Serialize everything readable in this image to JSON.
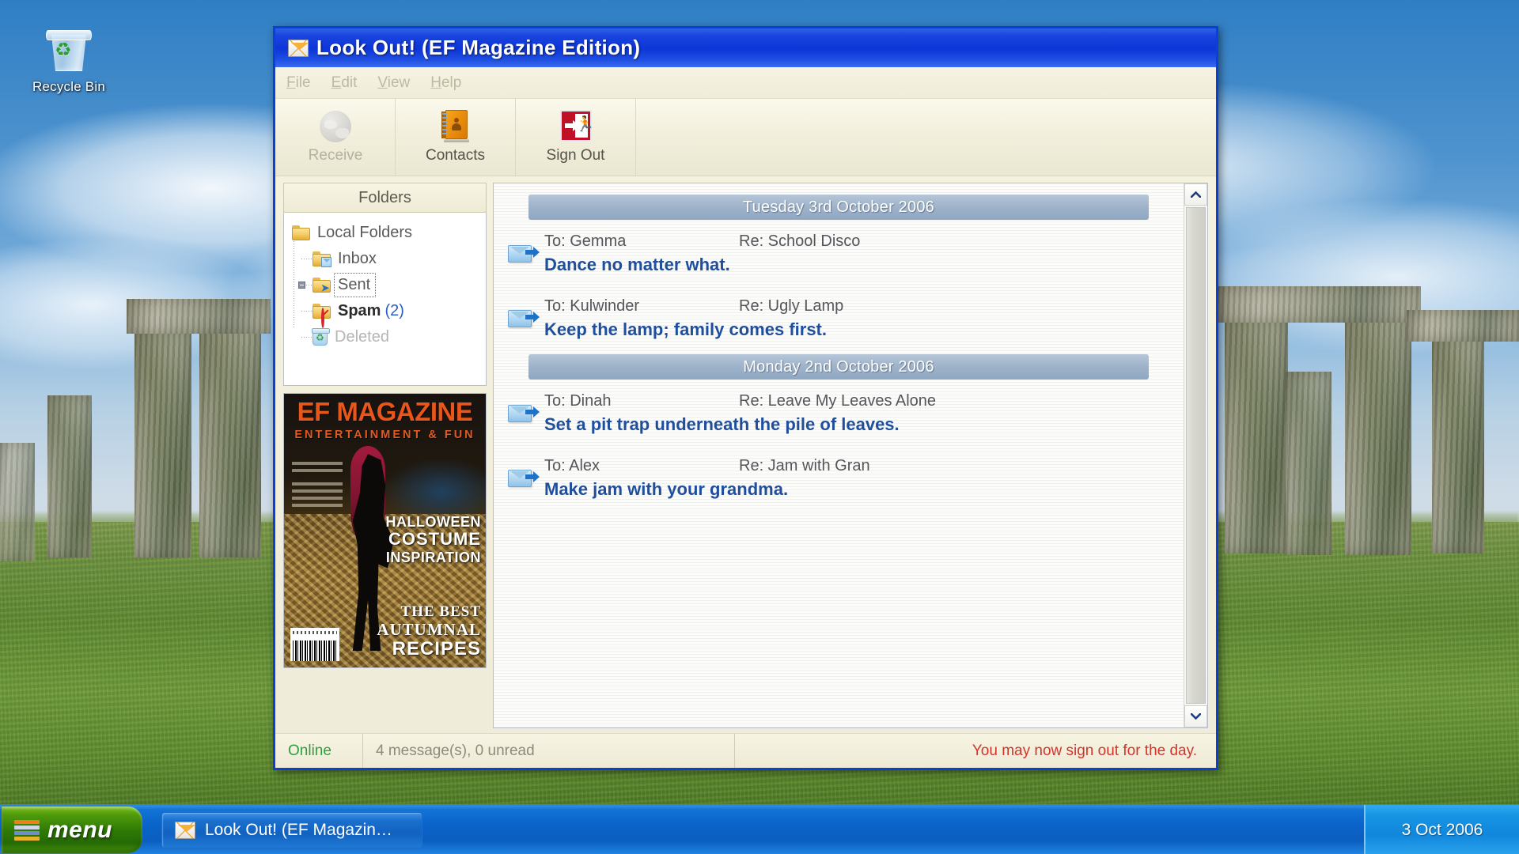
{
  "desktop": {
    "icons": [
      {
        "label": "Recycle Bin",
        "icon": "recycle-bin-icon"
      }
    ]
  },
  "window": {
    "title": "Look Out! (EF Magazine Edition)",
    "title_icon": "envelope-icon",
    "menu": [
      {
        "label": "File",
        "accel": "F",
        "disabled": true
      },
      {
        "label": "Edit",
        "accel": "E",
        "disabled": true
      },
      {
        "label": "View",
        "accel": "V",
        "disabled": true
      },
      {
        "label": "Help",
        "accel": "H",
        "disabled": true
      }
    ],
    "toolbar": [
      {
        "label": "Receive",
        "icon": "globe-icon",
        "disabled": true
      },
      {
        "label": "Contacts",
        "icon": "address-book-icon",
        "disabled": false
      },
      {
        "label": "Sign Out",
        "icon": "exit-sign-icon",
        "disabled": false
      }
    ]
  },
  "folders": {
    "header": "Folders",
    "root": {
      "label": "Local Folders",
      "icon": "folder-icon"
    },
    "items": [
      {
        "label": "Inbox",
        "icon": "folder-inbox-icon",
        "count": "",
        "selected": false,
        "bold": false,
        "disabled": false
      },
      {
        "label": "Sent",
        "icon": "folder-sent-icon",
        "count": "",
        "selected": true,
        "bold": false,
        "disabled": false
      },
      {
        "label": "Spam",
        "icon": "folder-spam-icon",
        "count": "(2)",
        "selected": false,
        "bold": true,
        "disabled": false
      },
      {
        "label": "Deleted",
        "icon": "folder-deleted-icon",
        "count": "",
        "selected": false,
        "bold": false,
        "disabled": true
      }
    ]
  },
  "advert": {
    "title": "EF MAGAZINE",
    "subtitle": "ENTERTAINMENT & FUN",
    "coverline_1": {
      "line1": "HALLOWEEN",
      "line2": "COSTUME",
      "line3": "INSPIRATION"
    },
    "coverline_2": {
      "line1": "THE BEST",
      "line2": "AUTUMNAL",
      "line3": "RECIPES"
    }
  },
  "messages": {
    "groups": [
      {
        "date": "Tuesday 3rd October 2006",
        "items": [
          {
            "to": "To: Gemma",
            "re": "Re: School Disco",
            "preview": "Dance no matter what.",
            "icon": "sent-mail-icon"
          },
          {
            "to": "To: Kulwinder",
            "re": "Re: Ugly Lamp",
            "preview": "Keep the lamp; family comes first.",
            "icon": "sent-mail-icon"
          }
        ]
      },
      {
        "date": "Monday 2nd October 2006",
        "items": [
          {
            "to": "To: Dinah",
            "re": "Re: Leave My Leaves Alone",
            "preview": "Set a pit trap underneath the pile of leaves.",
            "icon": "sent-mail-icon"
          },
          {
            "to": "To: Alex",
            "re": "Re: Jam with Gran",
            "preview": "Make jam with your grandma.",
            "icon": "sent-mail-icon"
          }
        ]
      }
    ]
  },
  "statusbar": {
    "connection": "Online",
    "counts": "4 message(s), 0 unread",
    "notice": "You may now sign out for the day."
  },
  "taskbar": {
    "start_label": "menu",
    "start_icon": "hamburger-menu-icon",
    "tasks": [
      {
        "label": "Look Out! (EF Magazin…",
        "icon": "envelope-icon"
      }
    ],
    "clock": "3 Oct 2006"
  },
  "colors": {
    "titlebar": "#0d35d8",
    "accent_blue": "#1f4e9c",
    "status_online": "#2f9e3f",
    "status_notice": "#d0352b",
    "magazine_orange": "#e8561a",
    "start_green": "#2f7a06"
  }
}
